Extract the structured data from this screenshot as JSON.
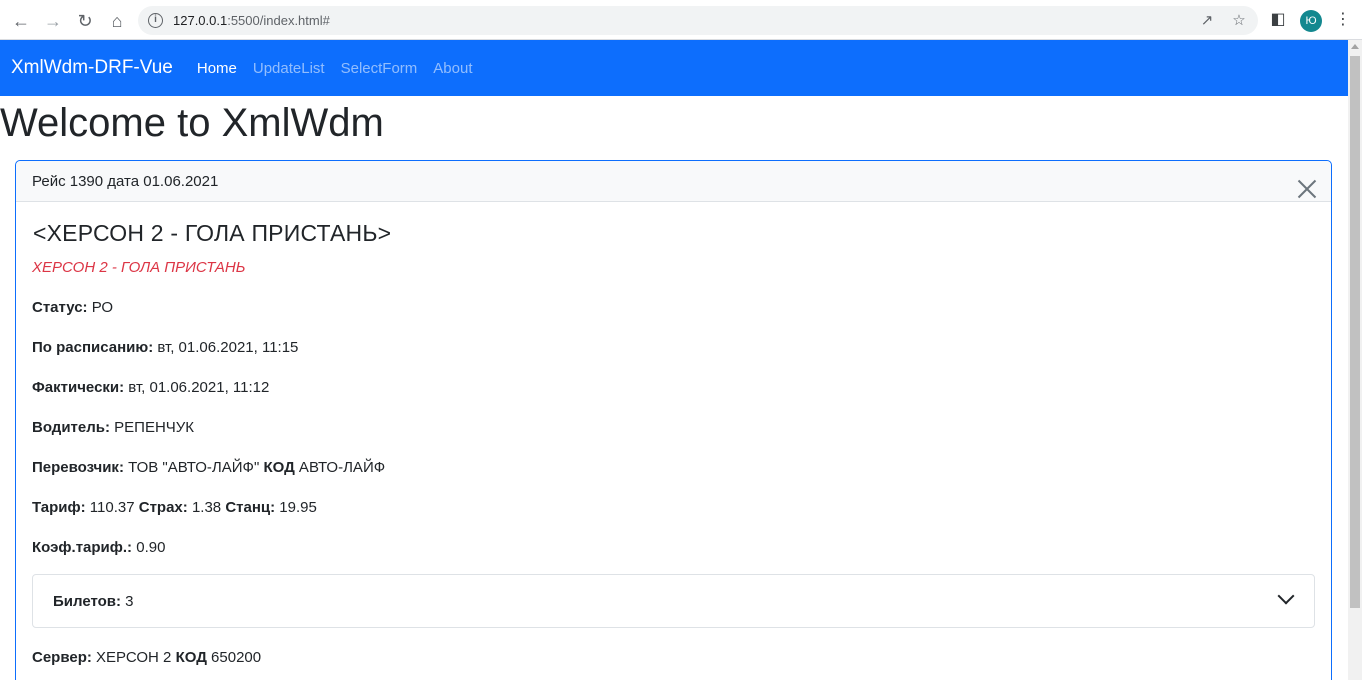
{
  "browser": {
    "url_host": "127.0.0.1",
    "url_rest": ":5500/index.html#",
    "profile_initial": "Ю"
  },
  "navbar": {
    "brand": "XmlWdm-DRF-Vue",
    "links": [
      "Home",
      "UpdateList",
      "SelectForm",
      "About"
    ],
    "active": "Home",
    "color": "#0d6efd"
  },
  "page": {
    "title": "Welcome to XmlWdm"
  },
  "card": {
    "header": "Рейс 1390 дата 01.06.2021",
    "route_title": "<ХЕРСОН 2 - ГОЛА ПРИСТАНЬ>",
    "route_sub": "ХЕРСОН 2 - ГОЛА ПРИСТАНЬ",
    "status": {
      "label": "Статус:",
      "value": " РО"
    },
    "scheduled": {
      "label": "По расписанию:",
      "value": " вт, 01.06.2021, 11:15"
    },
    "actual": {
      "label": "Фактически:",
      "value": " вт, 01.06.2021, 11:12"
    },
    "driver": {
      "label": "Водитель:",
      "value": " РЕПЕНЧУК"
    },
    "carrier": {
      "label": "Перевозчик:",
      "value": " ТОВ \"АВТО-ЛАЙФ\" ",
      "code_label": "КОД",
      "code_value": " АВТО-ЛАЙФ"
    },
    "tariff": {
      "label": "Тариф:",
      "value": " 110.37 ",
      "insurance_label": "Страх:",
      "insurance_value": " 1.38 ",
      "station_label": "Станц:",
      "station_value": " 19.95"
    },
    "coef": {
      "label": "Коэф.тариф.:",
      "value": " 0.90"
    },
    "tickets": {
      "label": "Билетов:",
      "value": " 3"
    },
    "server": {
      "label": "Сервер:",
      "value": " ХЕРСОН 2 ",
      "code_label": "КОД",
      "code_value": " 650200"
    }
  }
}
